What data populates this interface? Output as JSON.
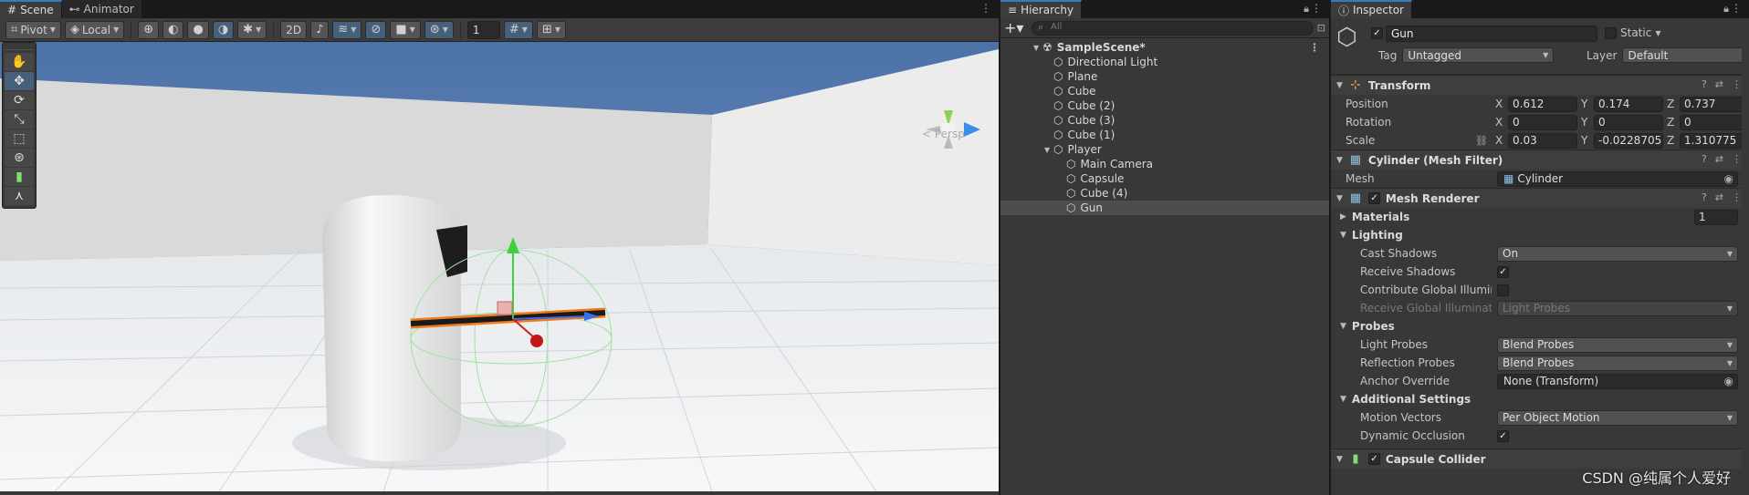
{
  "scene_panel": {
    "tabs": [
      {
        "label": "Scene",
        "icon": "hash-icon"
      },
      {
        "label": "Animator",
        "icon": "animator-icon"
      }
    ],
    "toolbar": {
      "pivot": "Pivot",
      "local": "Local",
      "mode_2d": "2D",
      "grid_value": "1"
    },
    "persp_label": "< Persp"
  },
  "hierarchy": {
    "tab": "Hierarchy",
    "search_placeholder": "All",
    "scene_name": "SampleScene*",
    "items": [
      {
        "label": "Directional Light",
        "depth": 1
      },
      {
        "label": "Plane",
        "depth": 1
      },
      {
        "label": "Cube",
        "depth": 1
      },
      {
        "label": "Cube (2)",
        "depth": 1
      },
      {
        "label": "Cube (3)",
        "depth": 1
      },
      {
        "label": "Cube (1)",
        "depth": 1
      },
      {
        "label": "Player",
        "depth": 1,
        "expanded": true
      },
      {
        "label": "Main Camera",
        "depth": 2
      },
      {
        "label": "Capsule",
        "depth": 2
      },
      {
        "label": "Cube (4)",
        "depth": 2
      },
      {
        "label": "Gun",
        "depth": 2,
        "selected": true
      }
    ]
  },
  "inspector": {
    "tab": "Inspector",
    "object_name": "Gun",
    "static_label": "Static",
    "tag_label": "Tag",
    "tag_value": "Untagged",
    "layer_label": "Layer",
    "layer_value": "Default",
    "transform": {
      "title": "Transform",
      "position_label": "Position",
      "position": {
        "x": "0.612",
        "y": "0.174",
        "z": "0.737"
      },
      "rotation_label": "Rotation",
      "rotation": {
        "x": "0",
        "y": "0",
        "z": "0"
      },
      "scale_label": "Scale",
      "scale": {
        "x": "0.03",
        "y": "-0.0228705",
        "z": "1.310775"
      }
    },
    "mesh_filter": {
      "title": "Cylinder (Mesh Filter)",
      "mesh_label": "Mesh",
      "mesh_value": "Cylinder"
    },
    "mesh_renderer": {
      "title": "Mesh Renderer",
      "materials_label": "Materials",
      "materials_count": "1",
      "lighting_label": "Lighting",
      "cast_shadows_label": "Cast Shadows",
      "cast_shadows_value": "On",
      "receive_shadows_label": "Receive Shadows",
      "contribute_gi_label": "Contribute Global Illumina",
      "receive_gi_label": "Receive Global Illuminatio",
      "receive_gi_value": "Light Probes",
      "probes_label": "Probes",
      "light_probes_label": "Light Probes",
      "light_probes_value": "Blend Probes",
      "reflection_probes_label": "Reflection Probes",
      "reflection_probes_value": "Blend Probes",
      "anchor_override_label": "Anchor Override",
      "anchor_override_value": "None (Transform)",
      "additional_label": "Additional Settings",
      "motion_vectors_label": "Motion Vectors",
      "motion_vectors_value": "Per Object Motion",
      "dynamic_occlusion_label": "Dynamic Occlusion"
    },
    "capsule_collider": {
      "title": "Capsule Collider"
    }
  },
  "watermark": "CSDN @纯属个人爱好",
  "colors": {
    "accent": "#3a79bb",
    "selection_orange": "#f07a1e",
    "panel": "#383838"
  }
}
